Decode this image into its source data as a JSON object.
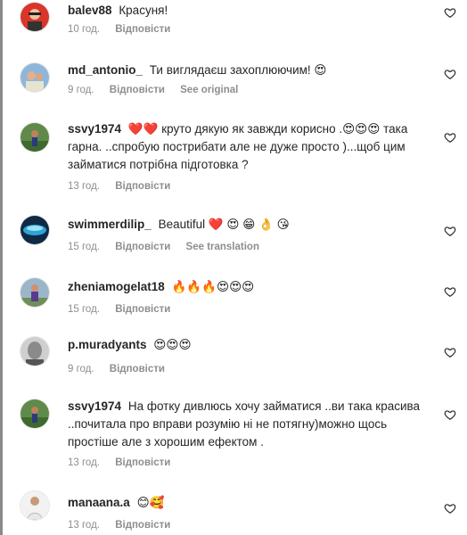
{
  "comments": [
    {
      "username": "balev88",
      "text": "Красуня!",
      "time": "10 год.",
      "reply": "Відповісти",
      "extra": ""
    },
    {
      "username": "md_antonio_",
      "text": "Ти виглядаєш захоплюючим! 😍",
      "time": "9 год.",
      "reply": "Відповісти",
      "extra": "See original"
    },
    {
      "username": "ssvy1974",
      "text": "❤️❤️ круто дякую як завжди корисно .😍😍😍 така гарна. ..спробую пострибати але не дуже просто )...щоб цим займатися потрібна підготовка ?",
      "time": "13 год.",
      "reply": "Відповісти",
      "extra": ""
    },
    {
      "username": "swimmerdilip_",
      "text": "Beautiful ❤️ 😍 😁 👌 😘",
      "time": "15 год.",
      "reply": "Відповісти",
      "extra": "See translation"
    },
    {
      "username": "zheniamogelat18",
      "text": "🔥🔥🔥😍😍😍",
      "time": "15 год.",
      "reply": "Відповісти",
      "extra": ""
    },
    {
      "username": "p.muradyants",
      "text": "😍😍😍",
      "time": "9 год.",
      "reply": "Відповісти",
      "extra": ""
    },
    {
      "username": "ssvy1974",
      "text": "На фотку дивлюсь хочу займатися ..ви така красива ..почитала про вправи розумію ні не потягну)можно щось простіше але з хорошим ефектом .",
      "time": "13 год.",
      "reply": "Відповісти",
      "extra": ""
    },
    {
      "username": "manaana.a",
      "text": "😊🥰",
      "time": "13 год.",
      "reply": "Відповісти",
      "extra": ""
    }
  ]
}
